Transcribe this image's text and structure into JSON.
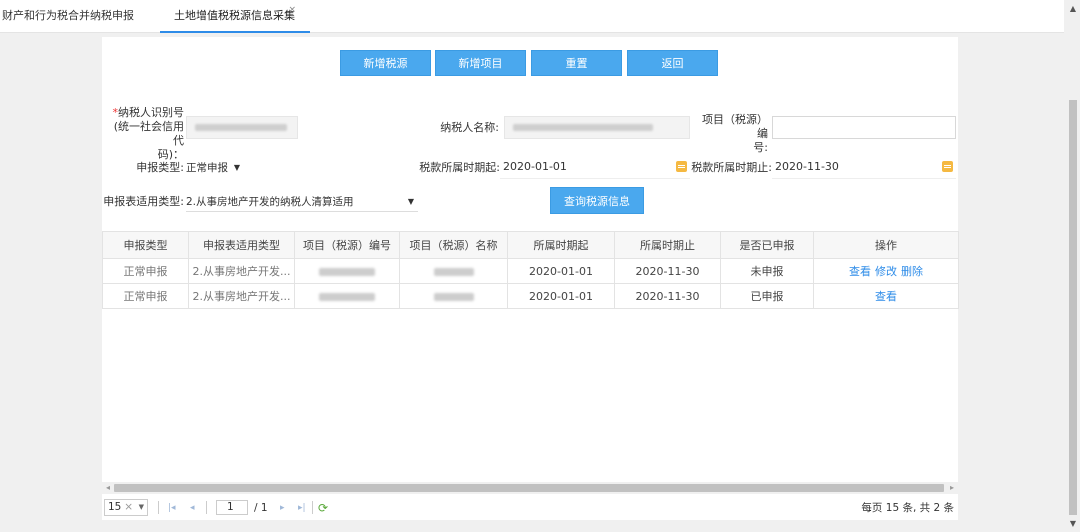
{
  "tabs": [
    {
      "label": "财产和行为税合并纳税申报"
    },
    {
      "label": "土地增值税税源信息采集",
      "close": "×"
    }
  ],
  "buttons": {
    "add_source": "新增税源",
    "add_project": "新增项目",
    "reset": "重置",
    "back": "返回",
    "query": "查询税源信息"
  },
  "form": {
    "taxpayer_id_label_line1": "纳税人识别号",
    "taxpayer_id_label_line2": "(统一社会信用代",
    "taxpayer_id_label_line3": "码)：",
    "required_mark": "*",
    "taxpayer_name_label": "纳税人名称:",
    "project_no_label_line1": "项目（税源）编",
    "project_no_label_line2": "号:",
    "project_no_value": "",
    "declare_type_label": "申报类型:",
    "declare_type_value": "正常申报",
    "period_start_label": "税款所属时期起:",
    "period_start_value": "2020-01-01",
    "period_end_label": "税款所属时期止:",
    "period_end_value": "2020-11-30",
    "form_type_label": "申报表适用类型:",
    "form_type_value": "2.从事房地产开发的纳税人清算适用"
  },
  "table": {
    "headers": [
      "申报类型",
      "申报表适用类型",
      "项目（税源）编号",
      "项目（税源）名称",
      "所属时期起",
      "所属时期止",
      "是否已申报",
      "操作"
    ],
    "rows": [
      {
        "type": "正常申报",
        "form_type": "2.从事房地产开发...",
        "start": "2020-01-01",
        "end": "2020-11-30",
        "declared": "未申报",
        "actions": [
          "查看",
          "修改",
          "删除"
        ]
      },
      {
        "type": "正常申报",
        "form_type": "2.从事房地产开发...",
        "start": "2020-01-01",
        "end": "2020-11-30",
        "declared": "已申报",
        "actions": [
          "查看"
        ]
      }
    ]
  },
  "pager": {
    "page_size": "15",
    "current_page": "1",
    "total_pages": "/ 1",
    "summary": "每页 15 条, 共 2 条"
  },
  "colors": {
    "accent": "#4aa8ee",
    "link": "#2e8ce8",
    "required": "#e33333"
  }
}
